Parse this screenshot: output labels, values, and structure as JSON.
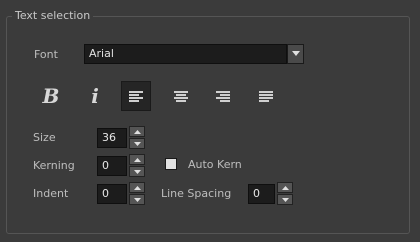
{
  "panel": {
    "title": "Text selection"
  },
  "font": {
    "label": "Font",
    "value": "Arial"
  },
  "toolbar": {
    "bold_icon": "bold-icon",
    "italic_icon": "italic-icon",
    "align_left_icon": "align-left-icon",
    "align_center_icon": "align-center-icon",
    "align_right_icon": "align-right-icon",
    "justify_icon": "align-justify-icon",
    "active": "align-left"
  },
  "size": {
    "label": "Size",
    "value": "36"
  },
  "kerning": {
    "label": "Kerning",
    "value": "0"
  },
  "auto_kern": {
    "label": "Auto Kern",
    "checked": false
  },
  "indent": {
    "label": "Indent",
    "value": "0"
  },
  "line_spacing": {
    "label": "Line Spacing",
    "value": "0"
  },
  "colors": {
    "background": "#3b3b3b",
    "field": "#1c1c1c",
    "text": "#cfcfcf"
  }
}
